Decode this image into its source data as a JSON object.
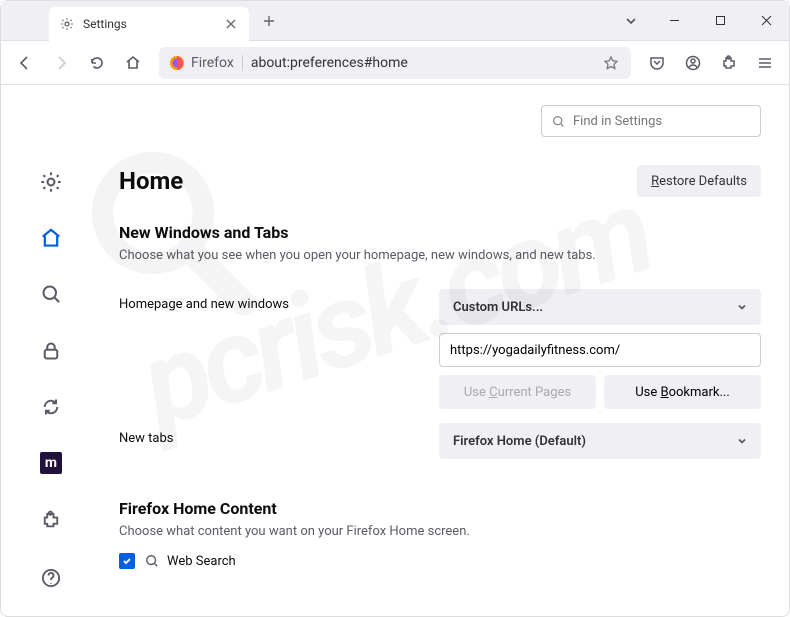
{
  "tab": {
    "title": "Settings"
  },
  "urlbar": {
    "identity": "Firefox",
    "url": "about:preferences#home"
  },
  "search": {
    "placeholder": "Find in Settings"
  },
  "page": {
    "title": "Home",
    "restore": "Restore Defaults",
    "section1": {
      "heading": "New Windows and Tabs",
      "desc": "Choose what you see when you open your homepage, new windows, and new tabs."
    },
    "homepage": {
      "label": "Homepage and new windows",
      "select": "Custom URLs...",
      "url": "https://yogadailyfitness.com/",
      "useCurrentPrefix": "Use ",
      "useCurrentUl": "C",
      "useCurrentSuffix": "urrent Pages",
      "useBookmarkPrefix": "Use ",
      "useBookmarkUl": "B",
      "useBookmarkSuffix": "ookmark..."
    },
    "newtabs": {
      "label": "New tabs",
      "select": "Firefox Home (Default)"
    },
    "section2": {
      "heading": "Firefox Home Content",
      "desc": "Choose what content you want on your Firefox Home screen.",
      "websearch": "Web Search"
    }
  },
  "mozilla": "m"
}
